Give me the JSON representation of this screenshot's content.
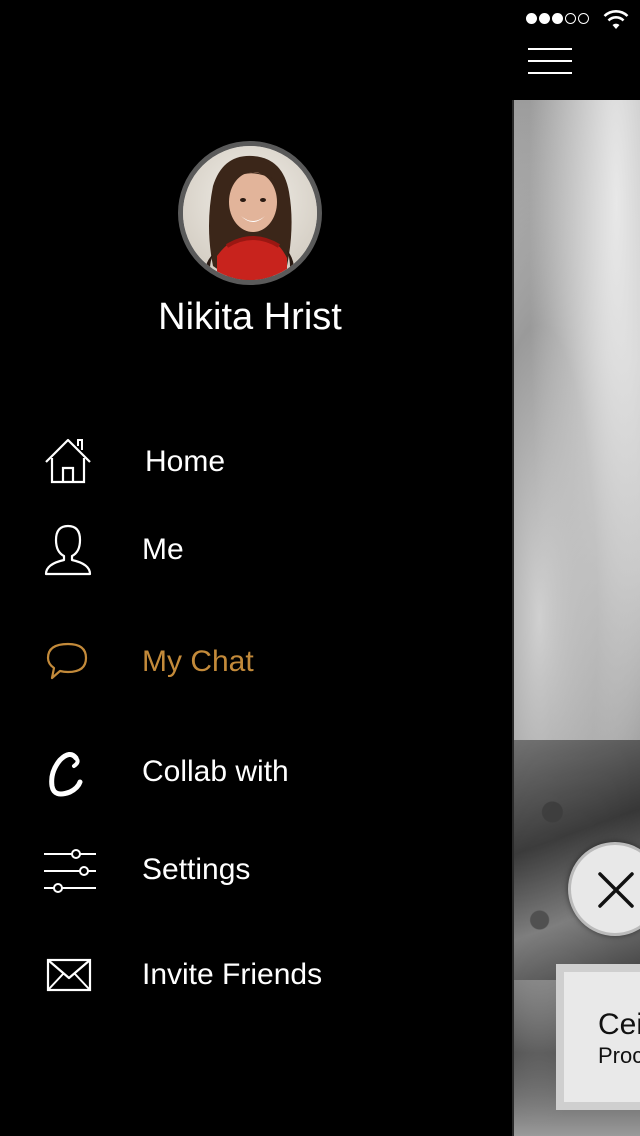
{
  "status_bar": {
    "signal_filled": 3,
    "signal_total": 5,
    "wifi_icon": "wifi-icon"
  },
  "header": {
    "menu_icon": "hamburger-menu-icon"
  },
  "profile": {
    "name": "Nikita Hrist",
    "avatar_icon": "avatar"
  },
  "menu": {
    "items": [
      {
        "label": "Home",
        "icon": "home-icon",
        "active": false
      },
      {
        "label": "Me",
        "icon": "user-icon",
        "active": false
      },
      {
        "label": "My Chat",
        "icon": "chat-bubble-icon",
        "active": true
      },
      {
        "label": "Collab with",
        "icon": "collab-icon",
        "active": false
      },
      {
        "label": "Settings",
        "icon": "sliders-icon",
        "active": false
      },
      {
        "label": "Invite Friends",
        "icon": "envelope-icon",
        "active": false
      }
    ]
  },
  "content_peek": {
    "card_title": "Cei",
    "card_subtitle": "Proc",
    "close_icon": "close-icon"
  },
  "colors": {
    "background": "#000000",
    "text": "#ffffff",
    "accent": "#c38a3a"
  }
}
